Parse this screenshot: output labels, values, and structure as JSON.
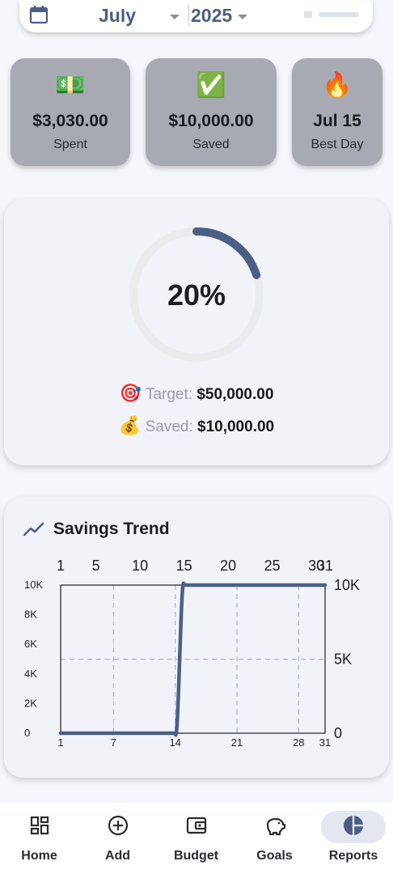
{
  "header": {
    "month": "July",
    "year": "2025"
  },
  "stats": [
    {
      "emoji": "💵",
      "value": "$3,030.00",
      "label": "Spent"
    },
    {
      "emoji": "✅",
      "value": "$10,000.00",
      "label": "Saved"
    },
    {
      "emoji": "🔥",
      "value": "Jul 15",
      "label": "Best Day"
    }
  ],
  "progress": {
    "percent_text": "20%",
    "fraction": 0.2,
    "target_emoji": "🎯",
    "target_label": "Target:",
    "target_value": "$50,000.00",
    "saved_emoji": "💰",
    "saved_label": "Saved:",
    "saved_value": "$10,000.00",
    "accent": "#4b5e86",
    "track": "#ececee"
  },
  "trend": {
    "title": "Savings Trend"
  },
  "chart_data": {
    "type": "line",
    "title": "Savings Trend",
    "x": [
      1,
      7,
      13,
      14,
      15,
      21,
      28,
      31
    ],
    "series": [
      {
        "values": [
          0,
          0,
          0,
          0,
          10000,
          10000,
          10000,
          10000
        ]
      }
    ],
    "color": "#4b5e86",
    "xlim": [
      1,
      31
    ],
    "ylim": [
      0,
      10000
    ],
    "x_ticks_top": [
      "1",
      "5",
      "10",
      "15",
      "20",
      "25",
      "30",
      "31"
    ],
    "x_ticks_bottom": [
      "1",
      "7",
      "14",
      "21",
      "28",
      "31"
    ],
    "y_ticks_left": [
      "0",
      "2K",
      "4K",
      "6K",
      "8K",
      "10K"
    ],
    "y_ticks_right": [
      "0",
      "5K",
      "10K"
    ],
    "grid": true
  },
  "nav": [
    {
      "label": "Home",
      "icon": "dashboard-icon",
      "active": false
    },
    {
      "label": "Add",
      "icon": "add-circle-icon",
      "active": false
    },
    {
      "label": "Budget",
      "icon": "wallet-icon",
      "active": false
    },
    {
      "label": "Goals",
      "icon": "piggy-bank-icon",
      "active": false
    },
    {
      "label": "Reports",
      "icon": "pie-chart-icon",
      "active": true
    }
  ]
}
